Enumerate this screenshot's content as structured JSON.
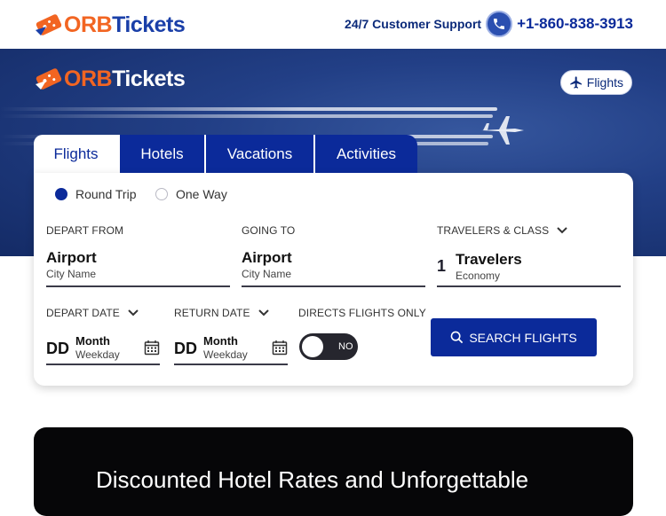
{
  "header": {
    "logo_prefix": "ORB",
    "logo_suffix": "Tickets",
    "support_label": "24/7 Customer Support",
    "phone": "+1-860-838-3913"
  },
  "hero": {
    "logo_prefix": "ORB",
    "logo_suffix": "Tickets",
    "flights_button": "Flights"
  },
  "tabs": [
    {
      "label": "Flights",
      "active": true
    },
    {
      "label": "Hotels",
      "active": false
    },
    {
      "label": "Vacations",
      "active": false
    },
    {
      "label": "Activities",
      "active": false
    }
  ],
  "trip_type": {
    "round_trip": "Round Trip",
    "one_way": "One Way",
    "selected": "Round Trip"
  },
  "depart_from": {
    "label": "DEPART FROM",
    "value": "Airport",
    "sub": "City Name"
  },
  "going_to": {
    "label": "GOING TO",
    "value": "Airport",
    "sub": "City Name"
  },
  "travelers": {
    "label": "TRAVELERS & CLASS",
    "count": "1",
    "value": "Travelers",
    "sub": "Economy"
  },
  "depart_date": {
    "label": "DEPART DATE",
    "dd": "DD",
    "month": "Month",
    "weekday": "Weekday"
  },
  "return_date": {
    "label": "RETURN DATE",
    "dd": "DD",
    "month": "Month",
    "weekday": "Weekday"
  },
  "direct_flights": {
    "label": "DIRECTS FLIGHTS ONLY",
    "toggle_text": "NO",
    "on": false
  },
  "search_button": "SEARCH FLIGHTS",
  "promo": {
    "title": "Discounted Hotel Rates and Unforgettable"
  },
  "colors": {
    "brand_blue": "#0b2a9a",
    "brand_orange": "#f26522",
    "hero_blue": "#223f86"
  }
}
